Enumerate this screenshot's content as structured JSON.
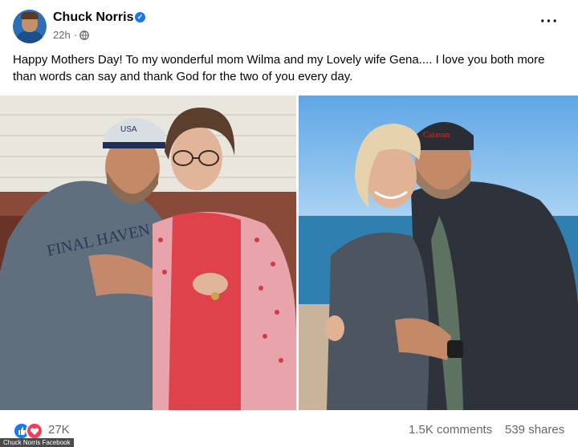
{
  "post": {
    "author": "Chuck Norris",
    "time": "22h",
    "separator": "·",
    "more": "···",
    "text": "Happy Mothers Day! To my wonderful mom Wilma and my Lovely wife Gena.... I love you both more than words can say and thank God for the two of you every day."
  },
  "reactions": {
    "count": "27K",
    "comments": "1.5K comments",
    "shares": "539 shares"
  },
  "credit": "Chuck Norris Facebook",
  "icons": {
    "verified": "verified-badge-icon",
    "privacy": "globe-icon",
    "like": "like-reaction-icon",
    "love": "love-reaction-icon"
  },
  "colors": {
    "accent": "#1877f2",
    "love": "#f33e58",
    "secondary_text": "#65676b"
  }
}
